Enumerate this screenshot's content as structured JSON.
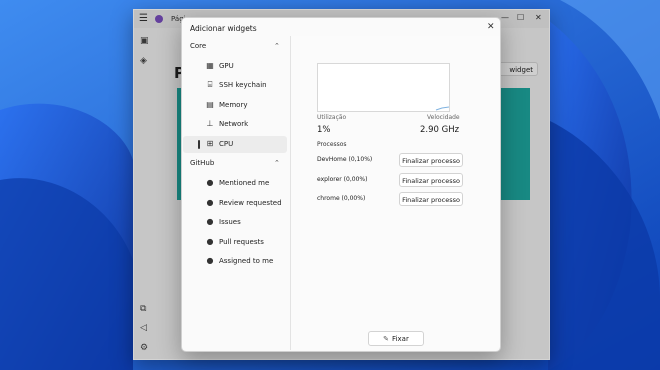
{
  "app": {
    "title": "Págin",
    "add_widget_label": "widget",
    "heading": "P"
  },
  "dialog": {
    "title": "Adicionar widgets",
    "groups": [
      {
        "label": "Core",
        "items": [
          {
            "label": "GPU",
            "icon": "gpu-icon",
            "selected": false
          },
          {
            "label": "SSH keychain",
            "icon": "ssh-keychain-icon",
            "selected": false
          },
          {
            "label": "Memory",
            "icon": "memory-icon",
            "selected": false
          },
          {
            "label": "Network",
            "icon": "network-icon",
            "selected": false
          },
          {
            "label": "CPU",
            "icon": "cpu-icon",
            "selected": true
          }
        ]
      },
      {
        "label": "GitHub",
        "items": [
          {
            "label": "Mentioned me",
            "icon": "github-icon"
          },
          {
            "label": "Review requested",
            "icon": "github-icon"
          },
          {
            "label": "Issues",
            "icon": "github-icon"
          },
          {
            "label": "Pull requests",
            "icon": "github-icon"
          },
          {
            "label": "Assigned to me",
            "icon": "github-icon"
          }
        ]
      }
    ],
    "cpu_widget": {
      "utilization_label": "Utilização",
      "utilization_value": "1%",
      "speed_label": "Velocidade",
      "speed_value": "2.90 GHz",
      "processes_label": "Processos",
      "processes": [
        {
          "name": "DevHome (0,10%)",
          "action": "Finalizar processo"
        },
        {
          "name": "explorer (0,00%)",
          "action": "Finalizar processo"
        },
        {
          "name": "chrome (0,00%)",
          "action": "Finalizar processo"
        }
      ]
    },
    "pin_label": "Fixar"
  },
  "colors": {
    "wallpaper": "#1a5bd6",
    "accent_card": "#1ea8a0"
  }
}
